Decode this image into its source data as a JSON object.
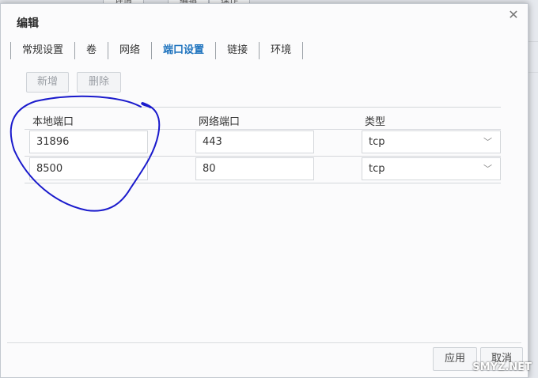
{
  "background": {
    "buttons": [
      "详情",
      "编辑",
      "操作"
    ]
  },
  "dialog": {
    "title": "编辑",
    "tabs": [
      {
        "label": "常规设置",
        "active": false
      },
      {
        "label": "卷",
        "active": false
      },
      {
        "label": "网络",
        "active": false
      },
      {
        "label": "端口设置",
        "active": true
      },
      {
        "label": "链接",
        "active": false
      },
      {
        "label": "环境",
        "active": false
      }
    ],
    "toolbar": {
      "add_label": "新增",
      "delete_label": "删除"
    },
    "table": {
      "headers": [
        "本地端口",
        "网络端口",
        "类型"
      ],
      "rows": [
        {
          "local": "31896",
          "network": "443",
          "type": "tcp"
        },
        {
          "local": "8500",
          "network": "80",
          "type": "tcp"
        }
      ]
    },
    "footer": {
      "apply_label": "应用",
      "cancel_label": "取消"
    }
  },
  "watermark": "SMYZ.NET",
  "colors": {
    "accent": "#1e73be",
    "annotation": "#1a1acc"
  }
}
